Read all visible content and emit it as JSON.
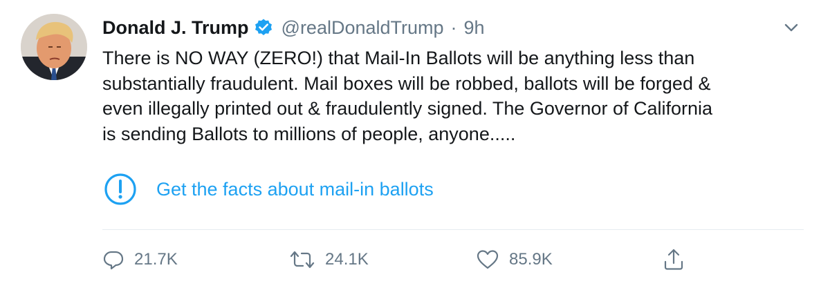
{
  "user": {
    "display_name": "Donald J. Trump",
    "handle": "@realDonaldTrump",
    "separator": "·",
    "timestamp": "9h",
    "verified": true,
    "avatar_icon": "profile-photo"
  },
  "tweet": {
    "text": "There is NO WAY (ZERO!) that Mail-In Ballots will be anything less than\nsubstantially fraudulent. Mail boxes will be robbed, ballots will be forged &\neven illegally printed out & fraudulently signed. The Governor of California\nis sending Ballots to millions of people, anyone....."
  },
  "notice": {
    "icon": "exclamation-circle-icon",
    "label": "Get the facts about mail-in ballots"
  },
  "actions": {
    "reply": {
      "icon": "reply-icon",
      "count": "21.7K"
    },
    "retweet": {
      "icon": "retweet-icon",
      "count": "24.1K"
    },
    "like": {
      "icon": "heart-icon",
      "count": "85.9K"
    },
    "share": {
      "icon": "share-icon"
    }
  },
  "menu": {
    "icon": "chevron-down-icon"
  },
  "colors": {
    "accent": "#1da1f2",
    "text": "#14171a",
    "muted": "#657786",
    "divider": "#e6ecf0"
  }
}
